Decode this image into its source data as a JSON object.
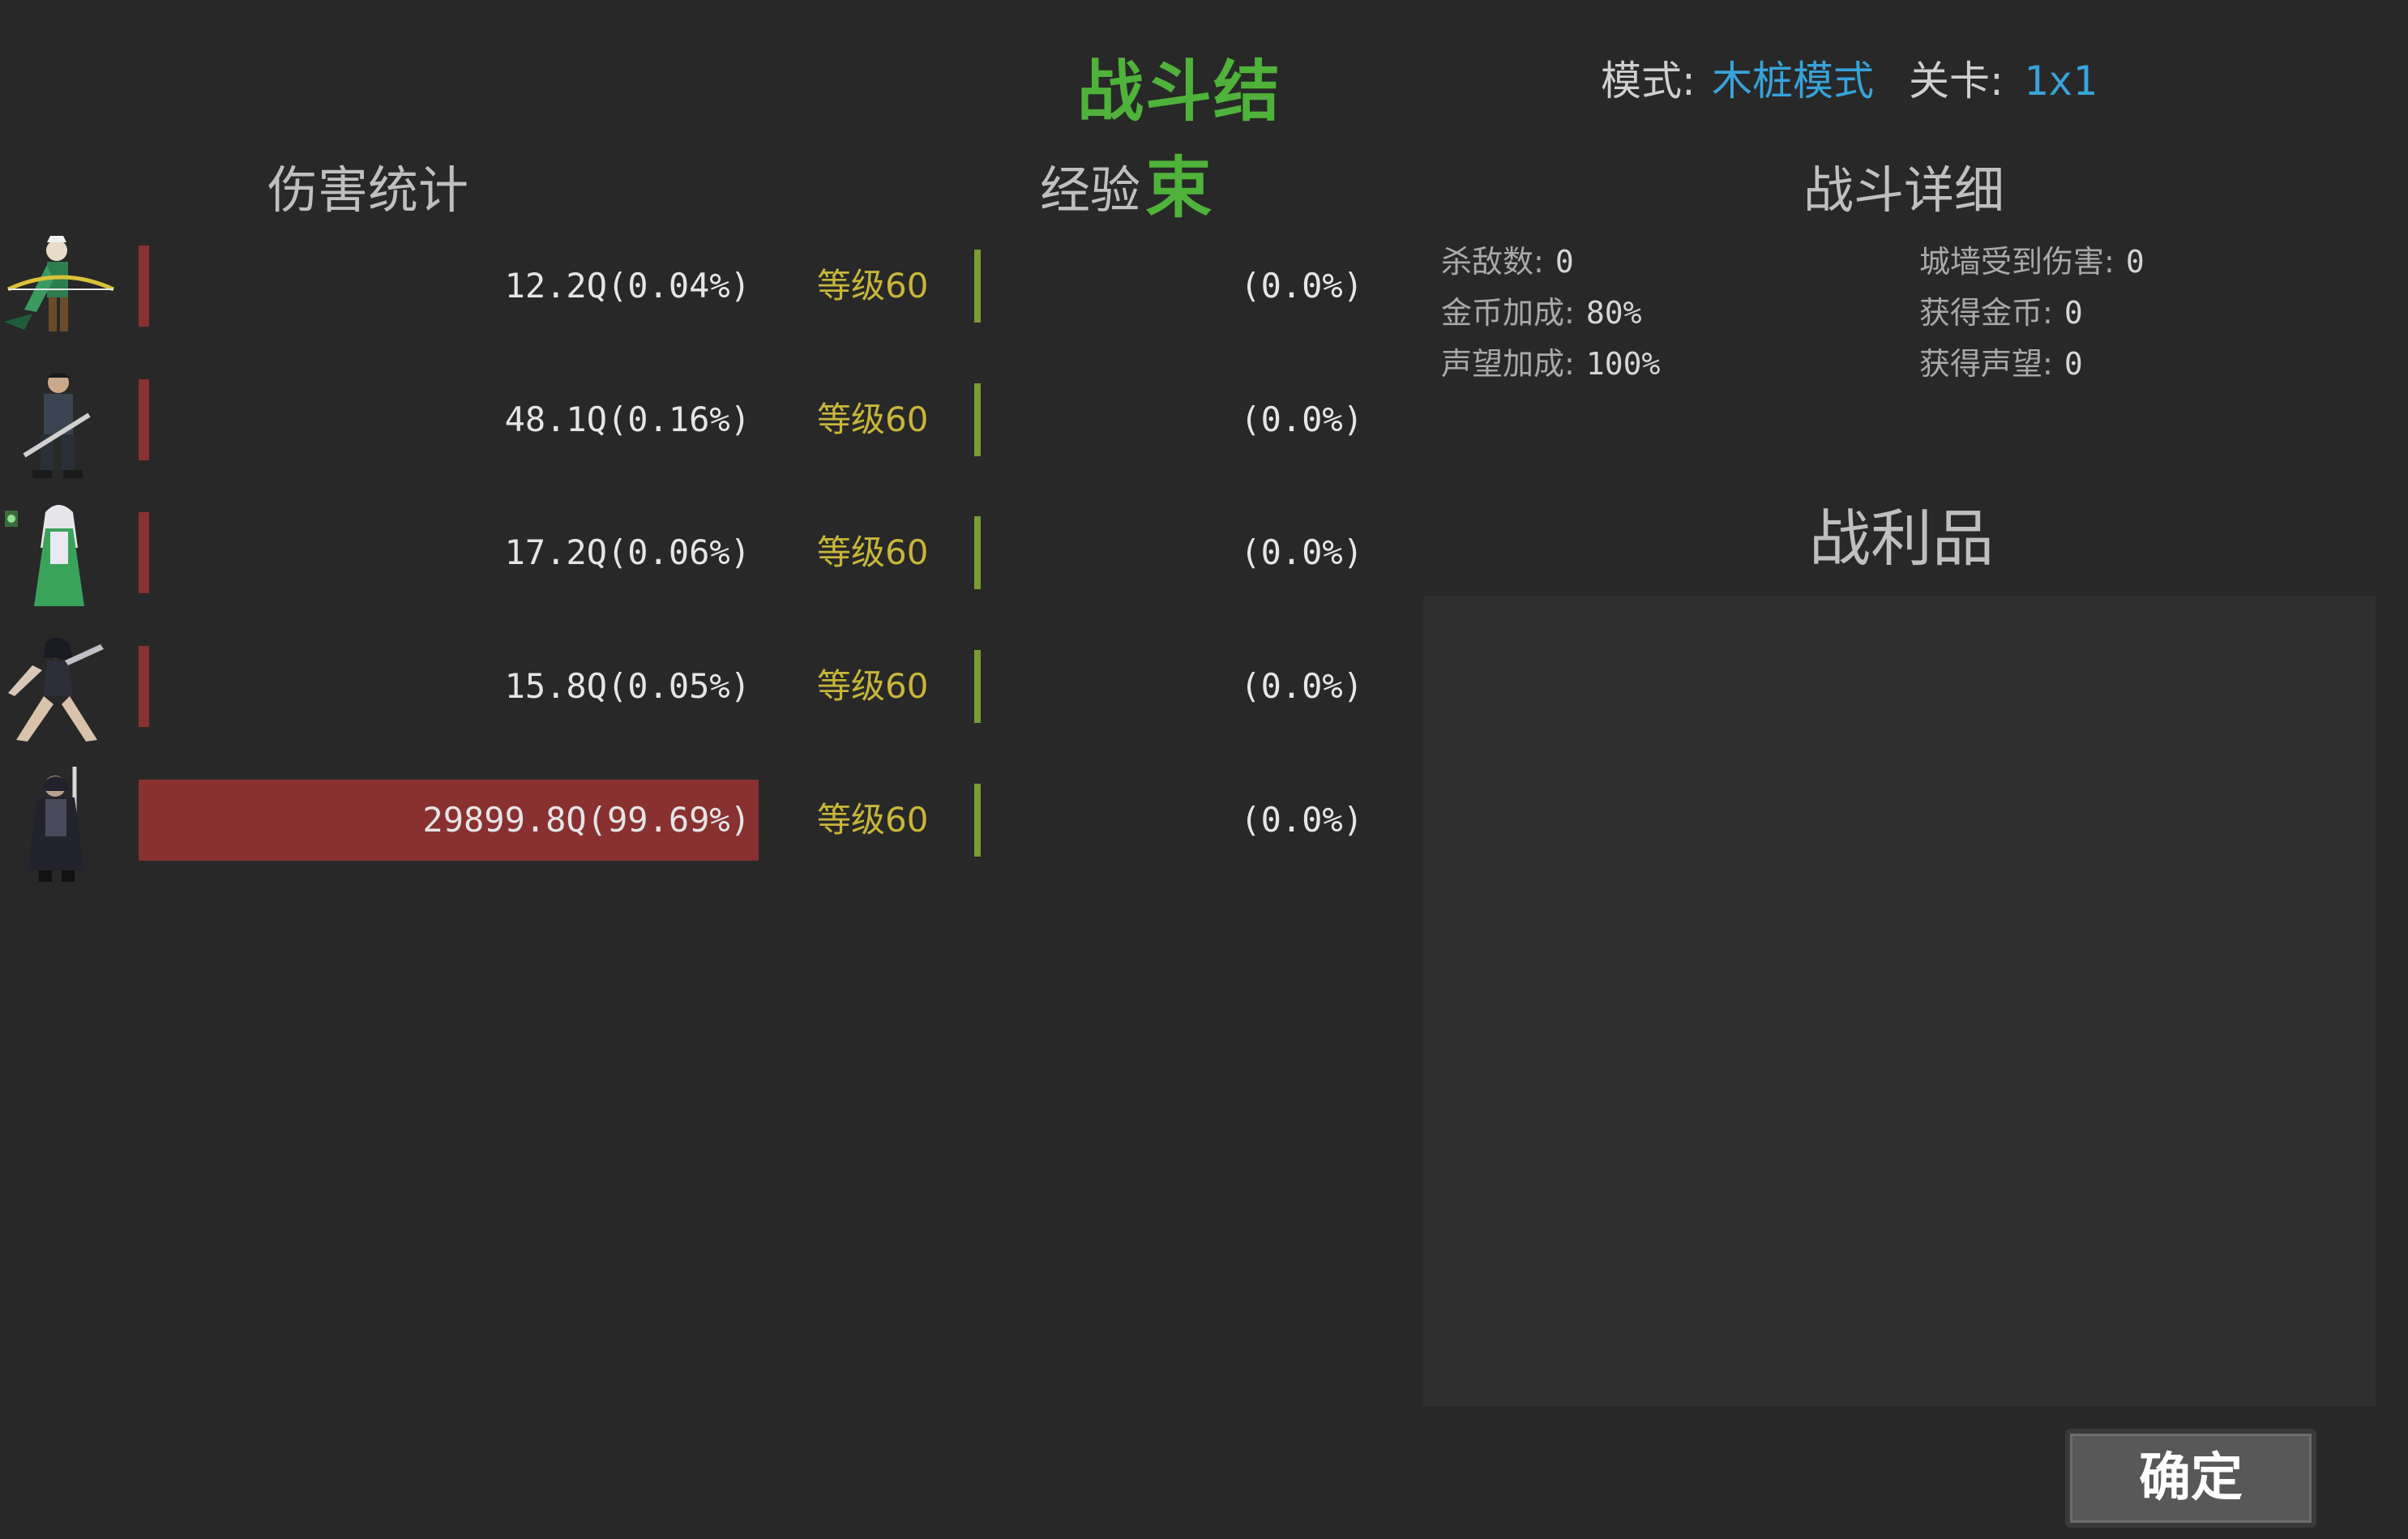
{
  "header": {
    "title": "战斗结束",
    "mode_label": "模式:",
    "mode_value": "木桩模式",
    "stage_label": "关卡:",
    "stage_value": "1x1"
  },
  "sections": {
    "damage": "伤害统计",
    "experience": "经验",
    "details": "战斗详细",
    "loot": "战利品"
  },
  "heroes": [
    {
      "portrait": "elf-archer-portrait",
      "damage": "12.2Q(0.04%)",
      "damage_fraction": 0.0004,
      "level": "等级60",
      "exp": "(0.0%)",
      "exp_fraction": 0.0
    },
    {
      "portrait": "swordsman-portrait",
      "damage": "48.1Q(0.16%)",
      "damage_fraction": 0.0016,
      "level": "等级60",
      "exp": "(0.0%)",
      "exp_fraction": 0.0
    },
    {
      "portrait": "elf-mage-portrait",
      "damage": "17.2Q(0.06%)",
      "damage_fraction": 0.0006,
      "level": "等级60",
      "exp": "(0.0%)",
      "exp_fraction": 0.0
    },
    {
      "portrait": "dancer-portrait",
      "damage": "15.8Q(0.05%)",
      "damage_fraction": 0.0005,
      "level": "等级60",
      "exp": "(0.0%)",
      "exp_fraction": 0.0
    },
    {
      "portrait": "dark-knight-portrait",
      "damage": "29899.8Q(99.69%)",
      "damage_fraction": 0.9969,
      "level": "等级60",
      "exp": "(0.0%)",
      "exp_fraction": 0.0
    }
  ],
  "details": {
    "kills_label": "杀敌数:",
    "kills_value": "0",
    "wall_damage_label": "城墙受到伤害:",
    "wall_damage_value": "0",
    "gold_bonus_label": "金币加成:",
    "gold_bonus_value": "80%",
    "gold_gained_label": "获得金币:",
    "gold_gained_value": "0",
    "fame_bonus_label": "声望加成:",
    "fame_bonus_value": "100%",
    "fame_gained_label": "获得声望:",
    "fame_gained_value": "0"
  },
  "buttons": {
    "confirm": "确定"
  },
  "colors": {
    "background": "#282828",
    "title_green": "#4fb23a",
    "link_blue": "#37a3d9",
    "damage_red": "#893131",
    "level_gold": "#c8b63a",
    "exp_green": "#7a9b36"
  }
}
